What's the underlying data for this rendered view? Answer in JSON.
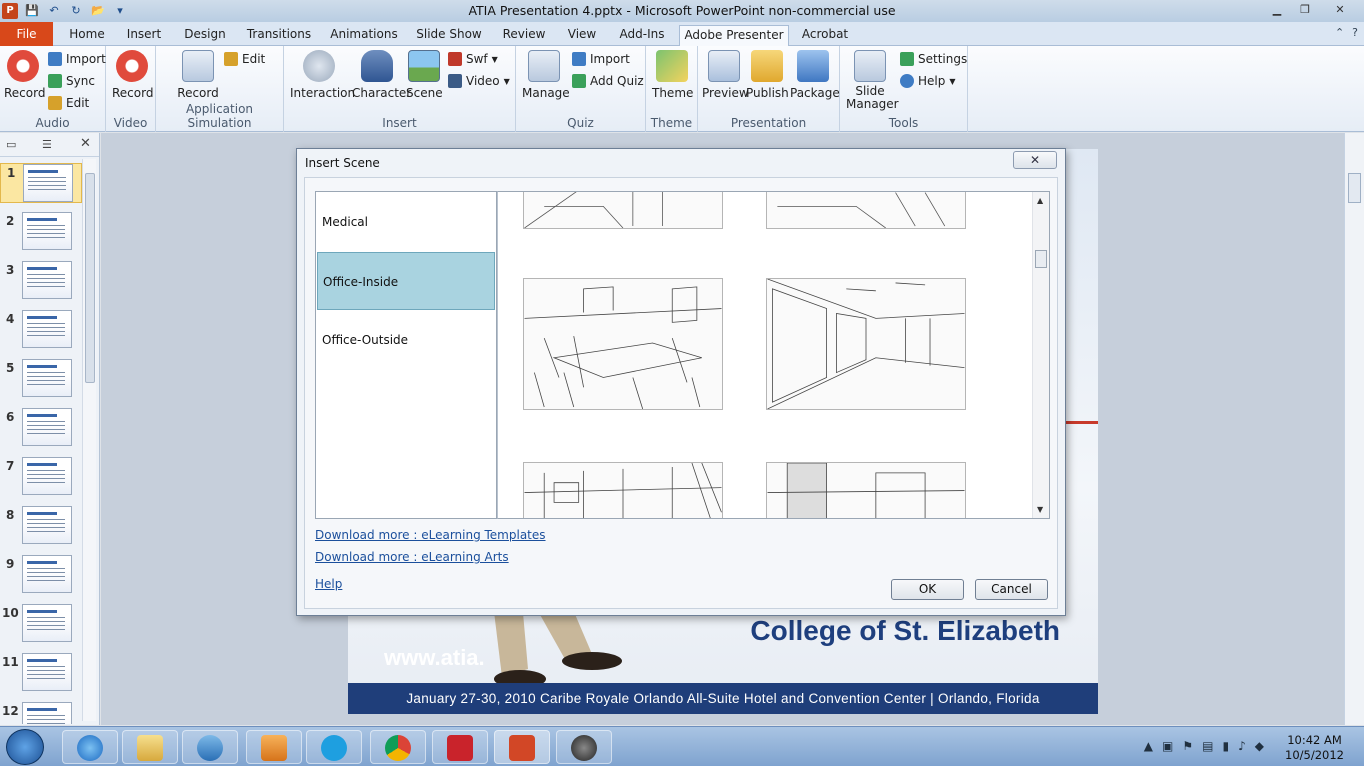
{
  "window": {
    "title": "ATIA Presentation 4.pptx - Microsoft PowerPoint non-commercial use"
  },
  "tabs": [
    {
      "label": "File"
    },
    {
      "label": "Home"
    },
    {
      "label": "Insert"
    },
    {
      "label": "Design"
    },
    {
      "label": "Transitions"
    },
    {
      "label": "Animations"
    },
    {
      "label": "Slide Show"
    },
    {
      "label": "Review"
    },
    {
      "label": "View"
    },
    {
      "label": "Add-Ins"
    },
    {
      "label": "Adobe Presenter"
    },
    {
      "label": "Acrobat"
    }
  ],
  "ribbon": {
    "audio": {
      "label": "Audio",
      "record": "Record",
      "import": "Import",
      "sync": "Sync",
      "edit": "Edit"
    },
    "video": {
      "label": "Video",
      "record": "Record"
    },
    "appsim": {
      "label": "Application Simulation",
      "record": "Record",
      "edit": "Edit"
    },
    "insert": {
      "label": "Insert",
      "interaction": "Interaction",
      "character": "Character",
      "scene": "Scene",
      "swf": "Swf",
      "video": "Video"
    },
    "quiz": {
      "label": "Quiz",
      "manage": "Manage",
      "import": "Import",
      "add_quiz": "Add Quiz"
    },
    "theme": {
      "label": "Theme",
      "theme": "Theme"
    },
    "presentation": {
      "label": "Presentation",
      "preview": "Preview",
      "publish": "Publish",
      "package": "Package"
    },
    "tools": {
      "label": "Tools",
      "slide_manager_1": "Slide",
      "slide_manager_2": "Manager",
      "settings": "Settings",
      "help": "Help"
    }
  },
  "slides": [
    {
      "num": "1"
    },
    {
      "num": "2"
    },
    {
      "num": "3"
    },
    {
      "num": "4"
    },
    {
      "num": "5"
    },
    {
      "num": "6"
    },
    {
      "num": "7"
    },
    {
      "num": "8"
    },
    {
      "num": "9"
    },
    {
      "num": "10"
    },
    {
      "num": "11"
    },
    {
      "num": "12"
    }
  ],
  "slide": {
    "college": "College of St. Elizabeth",
    "www": "www.atia.",
    "band": "January 27-30, 2010 Caribe Royale Orlando All-Suite Hotel and Convention Center  |  Orlando, Florida"
  },
  "dialog": {
    "title": "Insert Scene",
    "close": "✕",
    "categories": [
      "Medical",
      "Office-Inside",
      "Office-Outside"
    ],
    "selected_category": "Office-Inside",
    "link_templates": "Download more :  eLearning Templates",
    "link_arts": "Download more :  eLearning Arts",
    "help": "Help",
    "ok": "OK",
    "cancel": "Cancel"
  },
  "taskbar": {
    "time": "10:42 AM",
    "date": "10/5/2012"
  },
  "colors": {
    "file_tab": "#d8481a",
    "accent": "#1f3e7a",
    "selected_category": "#a9d3e0"
  }
}
